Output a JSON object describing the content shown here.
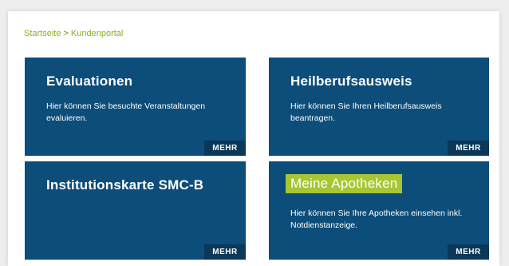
{
  "breadcrumb": {
    "home": "Startseite",
    "separator": ">",
    "current": "Kundenportal"
  },
  "tiles": [
    {
      "title": "Evaluationen",
      "description": "Hier können Sie besuchte Veranstaltungen evaluieren.",
      "more": "MEHR"
    },
    {
      "title": "Heilberufsausweis",
      "description": "Hier können Sie Ihren Heilberufsausweis beantragen.",
      "more": "MEHR"
    },
    {
      "title": "Institutionskarte SMC-B",
      "description": "",
      "more": "MEHR"
    },
    {
      "title": "Meine Apotheken",
      "description": "Hier können Sie Ihre Apotheken einsehen inkl. Notdienstanzeige.",
      "more": "MEHR"
    }
  ],
  "colors": {
    "tile_bg": "#0c4d7a",
    "more_bg": "#0a3856",
    "breadcrumb": "#8cb21d",
    "highlight": "#a8c534"
  }
}
